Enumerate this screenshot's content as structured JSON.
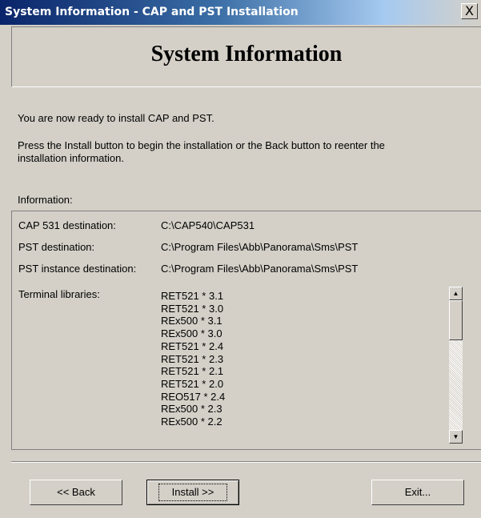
{
  "window": {
    "title": "System Information - CAP and PST Installation",
    "close_glyph": "X"
  },
  "header": {
    "title": "System Information"
  },
  "intro": {
    "line1": "You are now ready to install CAP and PST.",
    "line2a": "Press the Install button to begin the installation or the Back button to reenter the",
    "line2b": "installation information."
  },
  "info": {
    "heading": "Information:",
    "rows": [
      {
        "label": "CAP 531 destination:",
        "value": "C:\\CAP540\\CAP531"
      },
      {
        "label": "PST destination:",
        "value": "C:\\Program Files\\Abb\\Panorama\\Sms\\PST"
      },
      {
        "label": "PST instance destination:",
        "value": "C:\\Program Files\\Abb\\Panorama\\Sms\\PST"
      }
    ],
    "libraries_label": "Terminal libraries:",
    "libraries": [
      "RET521 * 3.1",
      "RET521 * 3.0",
      "REx500 * 3.1",
      "REx500 * 3.0",
      "RET521 * 2.4",
      "RET521 * 2.3",
      "RET521 * 2.1",
      "RET521 * 2.0",
      "REO517 * 2.4",
      "REx500 * 2.3",
      "REx500 * 2.2"
    ],
    "scroll_up_glyph": "▲",
    "scroll_down_glyph": "▼"
  },
  "buttons": {
    "back": "<< Back",
    "install": "Install >>",
    "exit": "Exit..."
  }
}
